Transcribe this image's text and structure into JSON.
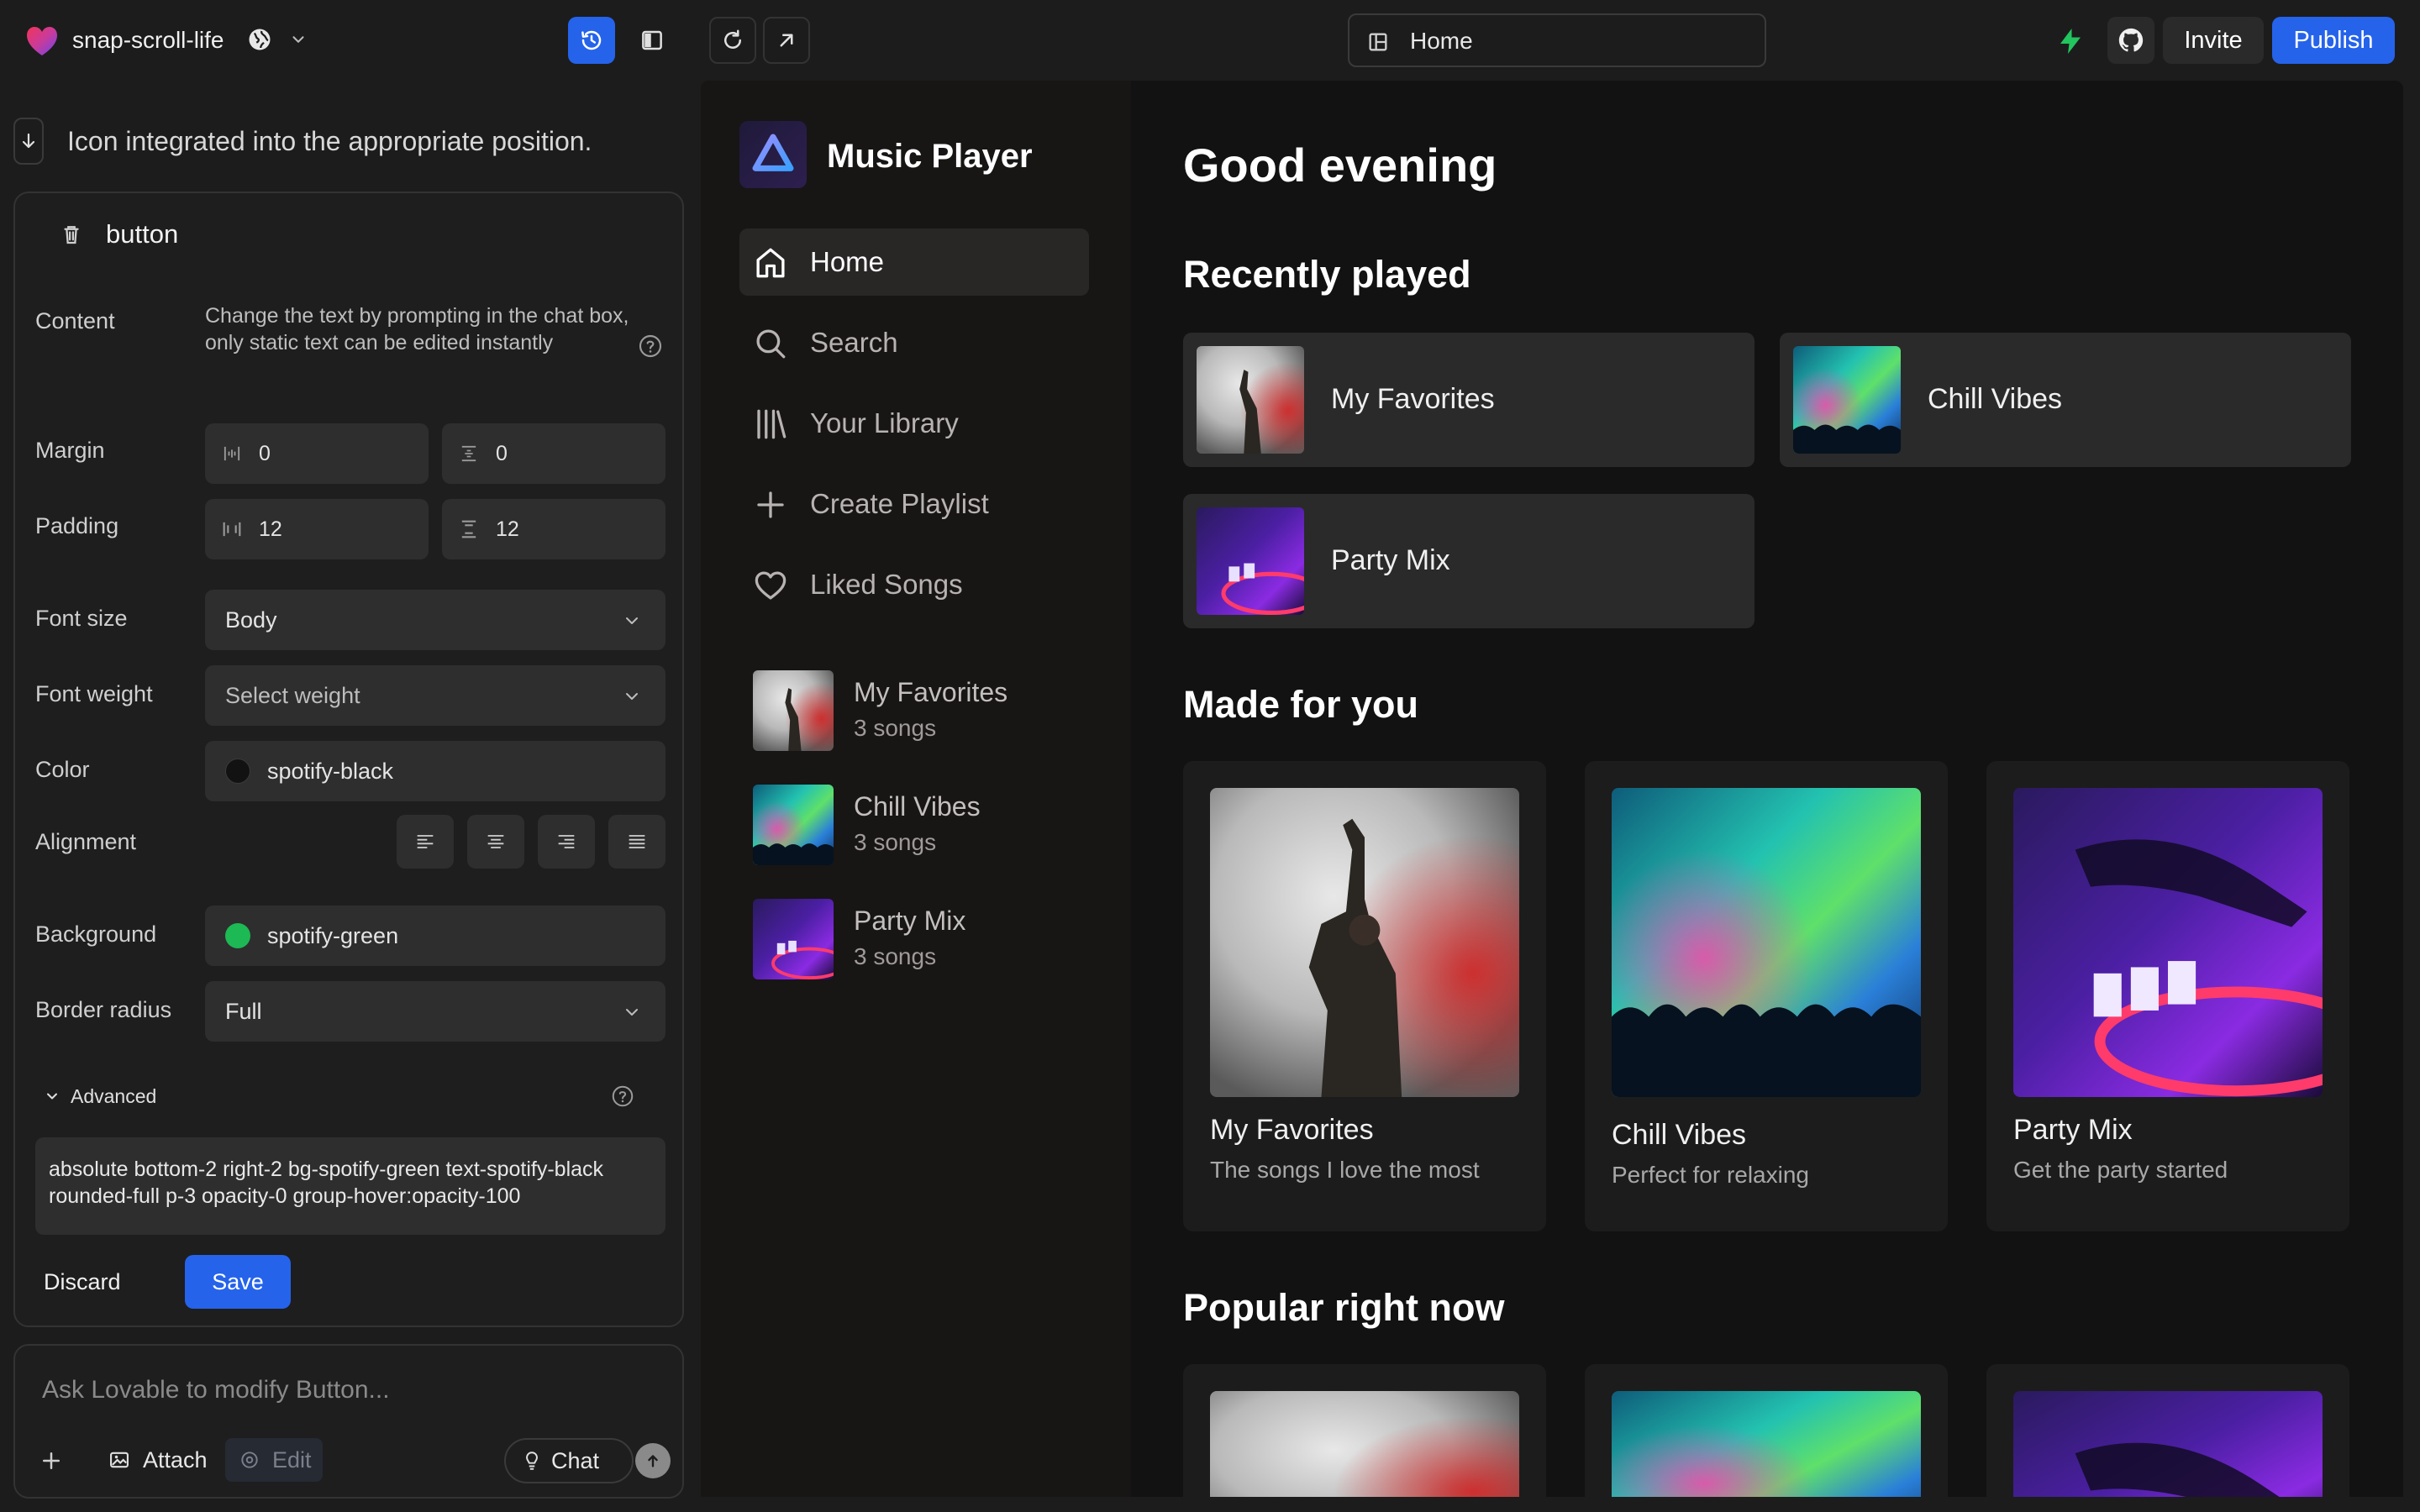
{
  "topbar": {
    "project_name": "snap-scroll-life",
    "url": "Home",
    "invite_label": "Invite",
    "publish_label": "Publish",
    "icons": [
      "lovable-logo",
      "globe-icon",
      "chevron-down-icon",
      "history-icon",
      "sidebar-toggle-icon",
      "refresh-icon",
      "external-link-icon",
      "layout-icon",
      "bolt-icon",
      "github-icon"
    ]
  },
  "chat": {
    "status_text": "Icon integrated into the appropriate position.",
    "placeholder": "Ask Lovable to modify Button...",
    "attach_label": "Attach",
    "edit_label": "Edit",
    "chat_label": "Chat"
  },
  "editor": {
    "element_name": "button",
    "content_label": "Content",
    "content_help": "Change the text by prompting in the chat box, only static text can be edited instantly",
    "margin_label": "Margin",
    "margin_x": "0",
    "margin_y": "0",
    "padding_label": "Padding",
    "padding_x": "12",
    "padding_y": "12",
    "font_size_label": "Font size",
    "font_size_value": "Body",
    "font_weight_label": "Font weight",
    "font_weight_placeholder": "Select weight",
    "color_label": "Color",
    "color_value": "spotify-black",
    "color_swatch": "#121212",
    "alignment_label": "Alignment",
    "background_label": "Background",
    "background_value": "spotify-green",
    "background_swatch": "#1db954",
    "border_radius_label": "Border radius",
    "border_radius_value": "Full",
    "advanced_label": "Advanced",
    "classes": "absolute bottom-2 right-2 bg-spotify-green text-spotify-black rounded-full p-3 opacity-0 group-hover:opacity-100",
    "discard_label": "Discard",
    "save_label": "Save"
  },
  "app": {
    "brand": "Music Player",
    "nav": [
      {
        "label": "Home",
        "icon": "home-icon"
      },
      {
        "label": "Search",
        "icon": "search-icon"
      },
      {
        "label": "Your Library",
        "icon": "library-icon"
      },
      {
        "label": "Create Playlist",
        "icon": "plus-icon"
      },
      {
        "label": "Liked Songs",
        "icon": "heart-icon"
      }
    ],
    "playlists": [
      {
        "name": "My Favorites",
        "count": "3 songs"
      },
      {
        "name": "Chill Vibes",
        "count": "3 songs"
      },
      {
        "name": "Party Mix",
        "count": "3 songs"
      }
    ],
    "greeting": "Good evening",
    "recently_played_title": "Recently played",
    "recently_played": [
      {
        "name": "My Favorites"
      },
      {
        "name": "Chill Vibes"
      },
      {
        "name": "Party Mix"
      }
    ],
    "made_for_you_title": "Made for you",
    "made_for_you": [
      {
        "title": "My Favorites",
        "desc": "The songs I love the most"
      },
      {
        "title": "Chill Vibes",
        "desc": "Perfect for relaxing"
      },
      {
        "title": "Party Mix",
        "desc": "Get the party started"
      }
    ],
    "popular_title": "Popular right now"
  },
  "colors": {
    "accent_blue": "#2563eb",
    "panel_bg": "#1c1c1c",
    "app_bg": "#121212",
    "bolt_green": "#22c55e"
  }
}
